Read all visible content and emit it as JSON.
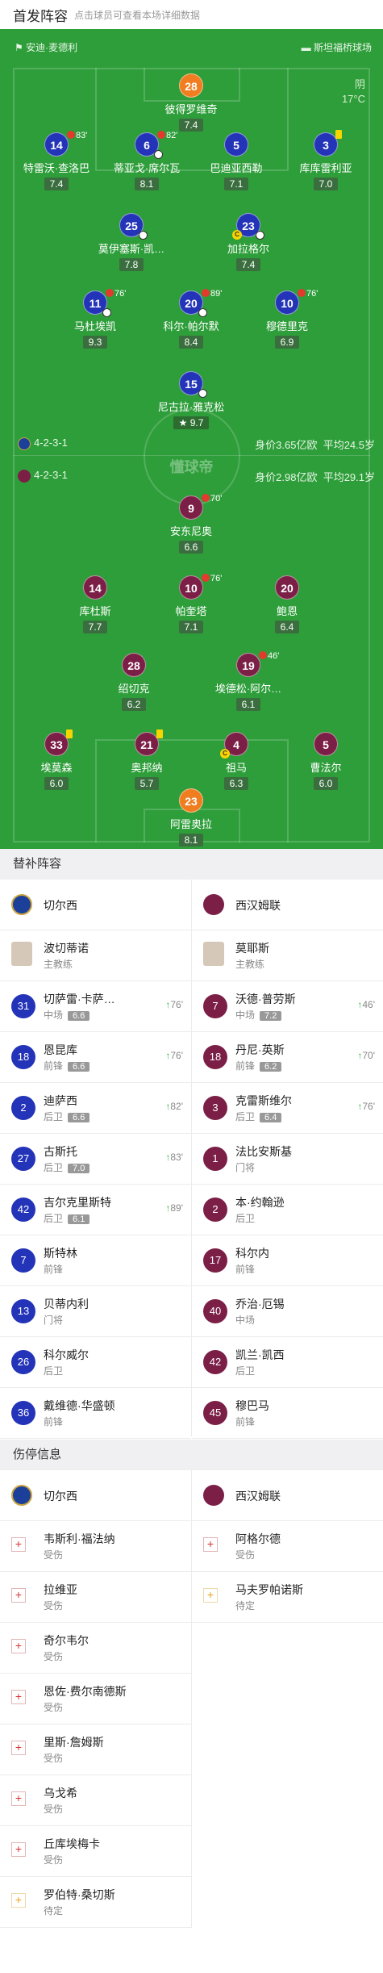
{
  "header": {
    "title": "首发阵容",
    "subtitle": "点击球员可查看本场详细数据"
  },
  "venue": {
    "referee": "安迪·麦德利",
    "stadium": "斯坦福桥球场"
  },
  "weather": {
    "condition": "阴",
    "temp": "17°C"
  },
  "home": {
    "formation": "4-2-3-1",
    "value": "身价3.65亿欧",
    "age": "平均24.5岁"
  },
  "away": {
    "formation": "4-2-3-1",
    "value": "身价2.98亿欧",
    "age": "平均29.1岁"
  },
  "brand_watermark": "懂球帝",
  "colors": {
    "chelsea": "#2434b8",
    "westham": "#7c1f47",
    "keeper": "#f07d1f",
    "pitch": "#2e9e3a"
  },
  "home_players": [
    {
      "num": "28",
      "name": "彼得罗维奇",
      "rating": "7.4",
      "kit": "orange"
    },
    {
      "num": "14",
      "name": "特雷沃·查洛巴",
      "rating": "7.4",
      "event": "83'",
      "kit": "blue"
    },
    {
      "num": "6",
      "name": "蒂亚戈·席尔瓦",
      "rating": "8.1",
      "event": "82'",
      "kit": "blue"
    },
    {
      "num": "5",
      "name": "巴迪亚西勒",
      "rating": "7.1",
      "kit": "blue"
    },
    {
      "num": "3",
      "name": "库库雷利亚",
      "rating": "7.0",
      "kit": "blue",
      "card": "yellow"
    },
    {
      "num": "25",
      "name": "莫伊塞斯·凯…",
      "rating": "7.8",
      "kit": "blue"
    },
    {
      "num": "23",
      "name": "加拉格尔",
      "rating": "7.4",
      "kit": "blue"
    },
    {
      "num": "11",
      "name": "马杜埃凯",
      "rating": "9.3",
      "event": "76'",
      "kit": "blue"
    },
    {
      "num": "20",
      "name": "科尔·帕尔默",
      "rating": "8.4",
      "event": "89'",
      "kit": "blue"
    },
    {
      "num": "10",
      "name": "穆德里克",
      "rating": "6.9",
      "event": "76'",
      "kit": "blue"
    },
    {
      "num": "15",
      "name": "尼古拉·雅克松",
      "rating": "9.7",
      "kit": "blue"
    }
  ],
  "away_players": [
    {
      "num": "9",
      "name": "安东尼奥",
      "rating": "6.6",
      "event": "70'"
    },
    {
      "num": "14",
      "name": "库杜斯",
      "rating": "7.7"
    },
    {
      "num": "10",
      "name": "帕奎塔",
      "rating": "7.1",
      "event": "76'"
    },
    {
      "num": "20",
      "name": "鲍恩",
      "rating": "6.4"
    },
    {
      "num": "28",
      "name": "绍切克",
      "rating": "6.2"
    },
    {
      "num": "19",
      "name": "埃德松·阿尔…",
      "rating": "6.1",
      "event": "46'"
    },
    {
      "num": "33",
      "name": "埃莫森",
      "rating": "6.0",
      "card": "yellow"
    },
    {
      "num": "21",
      "name": "奥邦纳",
      "rating": "5.7",
      "card": "yellow"
    },
    {
      "num": "4",
      "name": "祖马",
      "rating": "6.3"
    },
    {
      "num": "5",
      "name": "曹法尔",
      "rating": "6.0"
    },
    {
      "num": "23",
      "name": "阿雷奥拉",
      "rating": "8.1",
      "kit": "orange"
    }
  ],
  "subs": {
    "title": "替补阵容",
    "home_team": "切尔西",
    "away_team": "西汉姆联",
    "home_coach": {
      "name": "波切蒂诺",
      "role": "主教练"
    },
    "away_coach": {
      "name": "莫耶斯",
      "role": "主教练"
    },
    "home": [
      {
        "num": "31",
        "name": "切萨雷·卡萨…",
        "pos": "中场",
        "rating": "6.6",
        "min": "76'"
      },
      {
        "num": "18",
        "name": "恩昆库",
        "pos": "前锋",
        "rating": "6.6",
        "min": "76'"
      },
      {
        "num": "2",
        "name": "迪萨西",
        "pos": "后卫",
        "rating": "6.6",
        "min": "82'"
      },
      {
        "num": "27",
        "name": "古斯托",
        "pos": "后卫",
        "rating": "7.0",
        "min": "83'"
      },
      {
        "num": "42",
        "name": "吉尔克里斯特",
        "pos": "后卫",
        "rating": "6.1",
        "min": "89'"
      },
      {
        "num": "7",
        "name": "斯特林",
        "pos": "前锋"
      },
      {
        "num": "13",
        "name": "贝蒂内利",
        "pos": "门将"
      },
      {
        "num": "26",
        "name": "科尔威尔",
        "pos": "后卫"
      },
      {
        "num": "36",
        "name": "戴维德·华盛顿",
        "pos": "前锋"
      }
    ],
    "away": [
      {
        "num": "7",
        "name": "沃德·普劳斯",
        "pos": "中场",
        "rating": "7.2",
        "min": "46'"
      },
      {
        "num": "18",
        "name": "丹尼·英斯",
        "pos": "前锋",
        "rating": "6.2",
        "min": "70'"
      },
      {
        "num": "3",
        "name": "克雷斯维尔",
        "pos": "后卫",
        "rating": "6.4",
        "min": "76'"
      },
      {
        "num": "1",
        "name": "法比安斯基",
        "pos": "门将"
      },
      {
        "num": "2",
        "name": "本·约翰逊",
        "pos": "后卫"
      },
      {
        "num": "17",
        "name": "科尔内",
        "pos": "前锋"
      },
      {
        "num": "40",
        "name": "乔治·厄锡",
        "pos": "中场"
      },
      {
        "num": "42",
        "name": "凯兰·凯西",
        "pos": "后卫"
      },
      {
        "num": "45",
        "name": "穆巴马",
        "pos": "前锋"
      }
    ]
  },
  "injuries": {
    "title": "伤停信息",
    "home_team": "切尔西",
    "away_team": "西汉姆联",
    "home": [
      {
        "name": "韦斯利·福法纳",
        "status": "受伤",
        "type": "injured"
      },
      {
        "name": "拉维亚",
        "status": "受伤",
        "type": "injured"
      },
      {
        "name": "奇尔韦尔",
        "status": "受伤",
        "type": "injured"
      },
      {
        "name": "恩佐·费尔南德斯",
        "status": "受伤",
        "type": "injured"
      },
      {
        "name": "里斯·詹姆斯",
        "status": "受伤",
        "type": "injured"
      },
      {
        "name": "乌戈希",
        "status": "受伤",
        "type": "injured"
      },
      {
        "name": "丘库埃梅卡",
        "status": "受伤",
        "type": "injured"
      },
      {
        "name": "罗伯特·桑切斯",
        "status": "待定",
        "type": "doubt"
      }
    ],
    "away": [
      {
        "name": "阿格尔德",
        "status": "受伤",
        "type": "injured"
      },
      {
        "name": "马夫罗帕诺斯",
        "status": "待定",
        "type": "doubt"
      }
    ]
  }
}
